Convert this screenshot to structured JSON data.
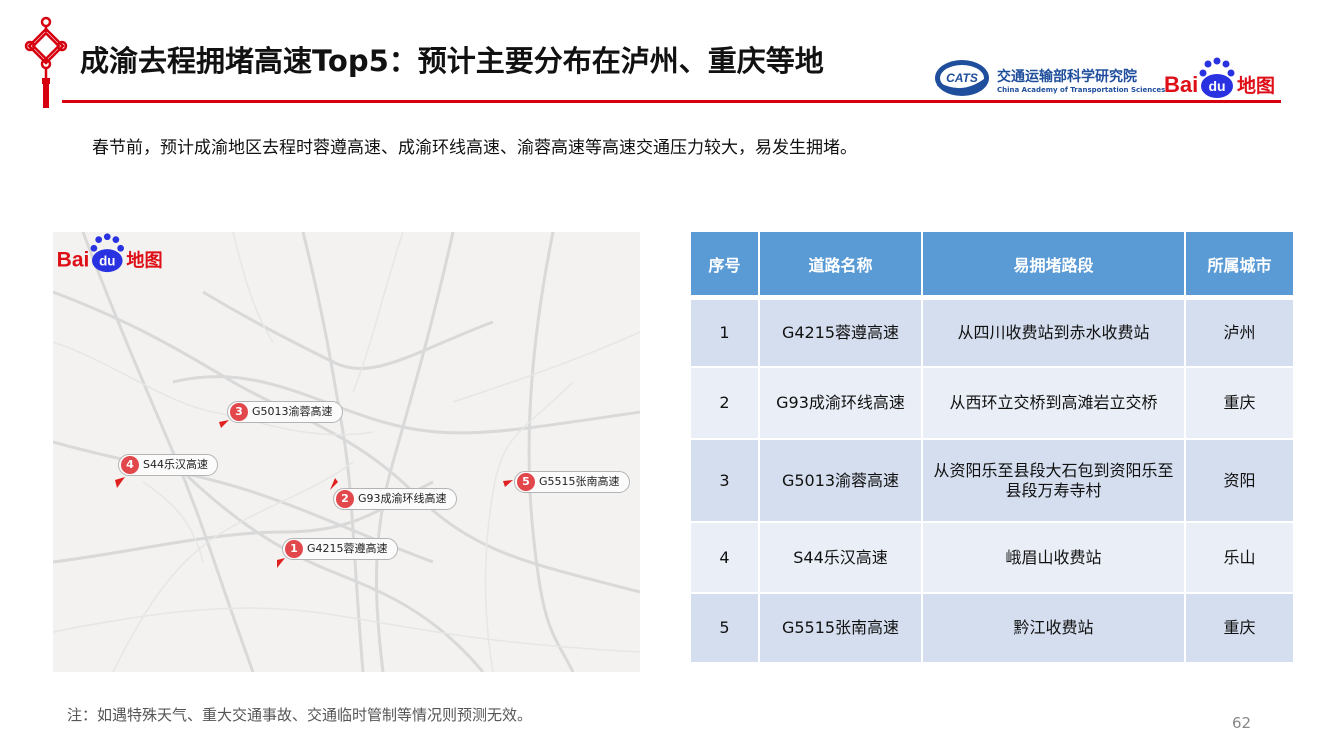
{
  "header": {
    "title": "成渝去程拥堵高速Top5：预计主要分布在泸州、重庆等地",
    "org_logo_mark": "CATS",
    "org_name_cn": "交通运输部科学研究院",
    "org_name_en": "China Academy of Transportation Sciences",
    "baidu_logo": {
      "bai": "Bai",
      "du": "du",
      "ditu": "地图"
    }
  },
  "intro": "春节前，预计成渝地区去程时蓉遵高速、成渝环线高速、渝蓉高速等高速交通压力较大，易发生拥堵。",
  "map": {
    "markers": [
      {
        "num": "1",
        "label": "G4215蓉遵高速"
      },
      {
        "num": "2",
        "label": "G93成渝环线高速"
      },
      {
        "num": "3",
        "label": "G5013渝蓉高速"
      },
      {
        "num": "4",
        "label": "S44乐汉高速"
      },
      {
        "num": "5",
        "label": "G5515张南高速"
      }
    ]
  },
  "table": {
    "headers": [
      "序号",
      "道路名称",
      "易拥堵路段",
      "所属城市"
    ],
    "rows": [
      [
        "1",
        "G4215蓉遵高速",
        "从四川收费站到赤水收费站",
        "泸州"
      ],
      [
        "2",
        "G93成渝环线高速",
        "从西环立交桥到高滩岩立交桥",
        "重庆"
      ],
      [
        "3",
        "G5013渝蓉高速",
        "从资阳乐至县段大石包到资阳乐至县段万寿寺村",
        "资阳"
      ],
      [
        "4",
        "S44乐汉高速",
        "峨眉山收费站",
        "乐山"
      ],
      [
        "5",
        "G5515张南高速",
        "黔江收费站",
        "重庆"
      ]
    ]
  },
  "note": "注：如遇特殊天气、重大交通事故、交通临时管制等情况则预测无效。",
  "page_number": "62",
  "colors": {
    "accent_red": "#d7000f",
    "table_header": "#5b9bd5",
    "table_row_dark": "#d5deef",
    "table_row_light": "#eaeff7",
    "marker_red": "#e2474c",
    "baidu_red": "#de0f17",
    "baidu_blue": "#2932e1"
  }
}
